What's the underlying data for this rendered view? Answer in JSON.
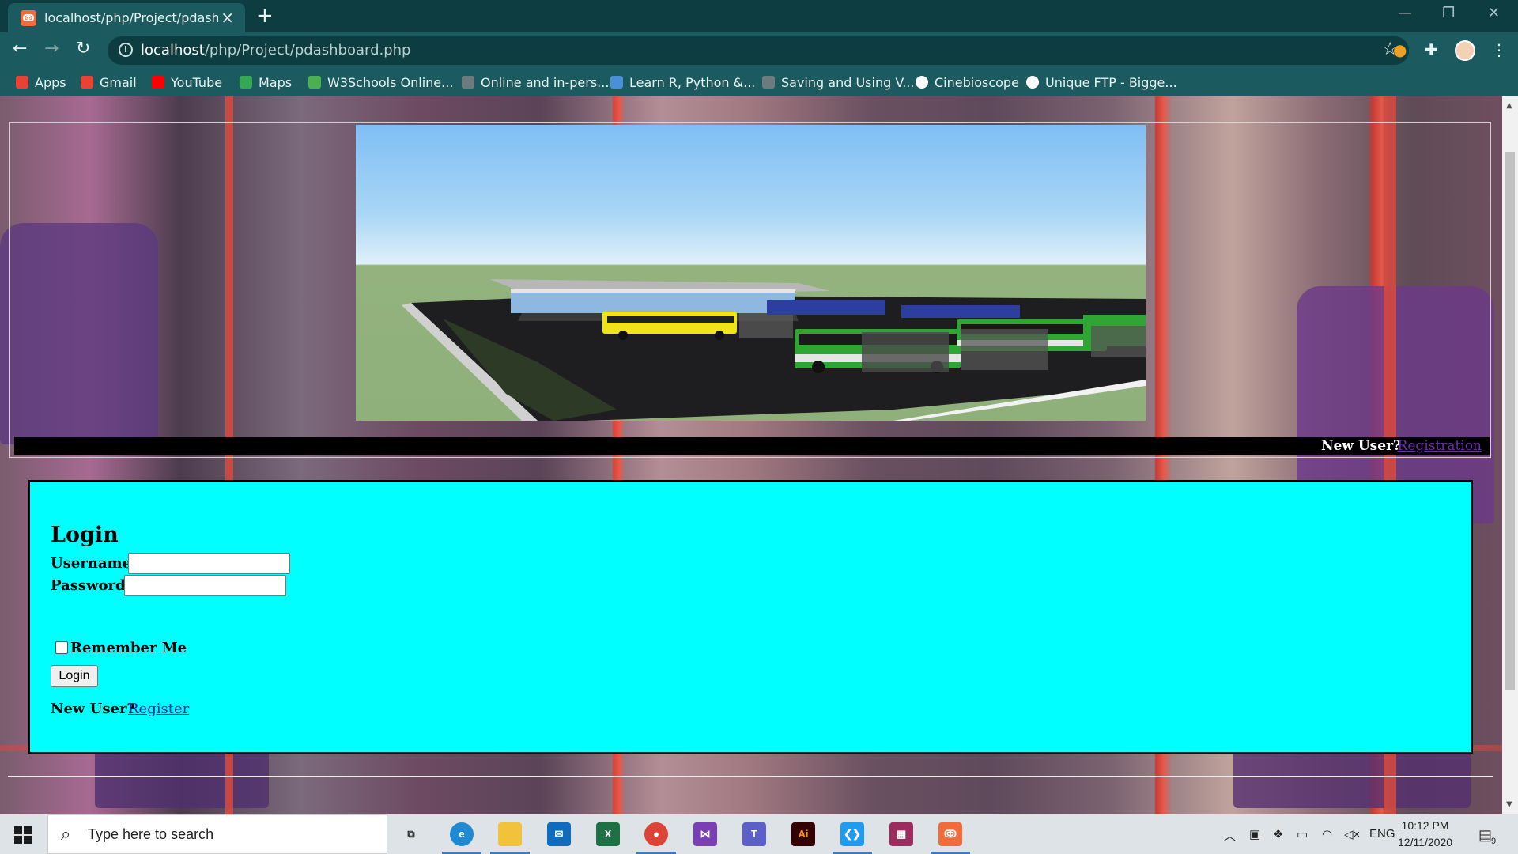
{
  "browser": {
    "tab_title": "localhost/php/Project/pdashboar",
    "tab_favicon": "xampp-icon",
    "url_host": "localhost",
    "url_path": "/php/Project/pdashboard.php"
  },
  "bookmarks": [
    {
      "label": "Apps",
      "icon": "apps-grid-icon",
      "color": "#e94235"
    },
    {
      "label": "Gmail",
      "icon": "gmail-icon",
      "color": "#ea4335"
    },
    {
      "label": "YouTube",
      "icon": "youtube-icon",
      "color": "#ff0000"
    },
    {
      "label": "Maps",
      "icon": "maps-icon",
      "color": "#34a853"
    },
    {
      "label": "W3Schools Online...",
      "icon": "w3schools-icon",
      "color": "#4caf50"
    },
    {
      "label": "Online and in-pers...",
      "icon": "globe-icon",
      "color": "#6b7b7e"
    },
    {
      "label": "Learn R, Python &...",
      "icon": "shield-icon",
      "color": "#4a90d9"
    },
    {
      "label": "Saving and Using V...",
      "icon": "feather-icon",
      "color": "#6b7b7e"
    },
    {
      "label": "Cinebioscope",
      "icon": "globe-icon",
      "color": "#ffffff"
    },
    {
      "label": "Unique FTP - Bigge...",
      "icon": "globe-icon",
      "color": "#ffffff"
    }
  ],
  "page": {
    "header": {
      "banner_image": "bus-terminal-render",
      "new_user_q": "New User?",
      "registration_link": "Registration"
    },
    "login": {
      "title": "Login",
      "username_label": "Username:",
      "username_value": "",
      "password_label": "Password:",
      "password_value": "",
      "remember_label": "Remember Me",
      "remember_checked": false,
      "login_button": "Login",
      "new_user_q": "New User?",
      "register_link": "Register"
    },
    "colors": {
      "login_bg": "#00ffff",
      "regbar_bg": "#000000",
      "link_visited": "#6b2fa6",
      "link": "#1a1aa6"
    }
  },
  "taskbar": {
    "search_placeholder": "Type here to search",
    "apps": [
      {
        "name": "task-view",
        "color": "#3a3a3a",
        "glyph": "⧉"
      },
      {
        "name": "edge",
        "color": "#1f8ad2",
        "glyph": "e"
      },
      {
        "name": "file-explorer",
        "color": "#f2c23b",
        "glyph": "▬"
      },
      {
        "name": "mail",
        "color": "#0f6cbd",
        "glyph": "✉"
      },
      {
        "name": "excel",
        "color": "#1e7145",
        "glyph": "X"
      },
      {
        "name": "chrome",
        "color": "#db4437",
        "glyph": "●"
      },
      {
        "name": "visual-studio",
        "color": "#7b3fb5",
        "glyph": "⋈"
      },
      {
        "name": "teams",
        "color": "#5b5fc7",
        "glyph": "T"
      },
      {
        "name": "illustrator",
        "color": "#330000",
        "glyph": "Ai"
      },
      {
        "name": "vscode",
        "color": "#1f9cf0",
        "glyph": "❮❯"
      },
      {
        "name": "winrar",
        "color": "#9b2d5e",
        "glyph": "▦"
      },
      {
        "name": "xampp",
        "color": "#f26b3a",
        "glyph": "ↂ"
      }
    ],
    "language": "ENG",
    "time": "10:12 PM",
    "date": "12/11/2020",
    "notification_count": "9"
  }
}
